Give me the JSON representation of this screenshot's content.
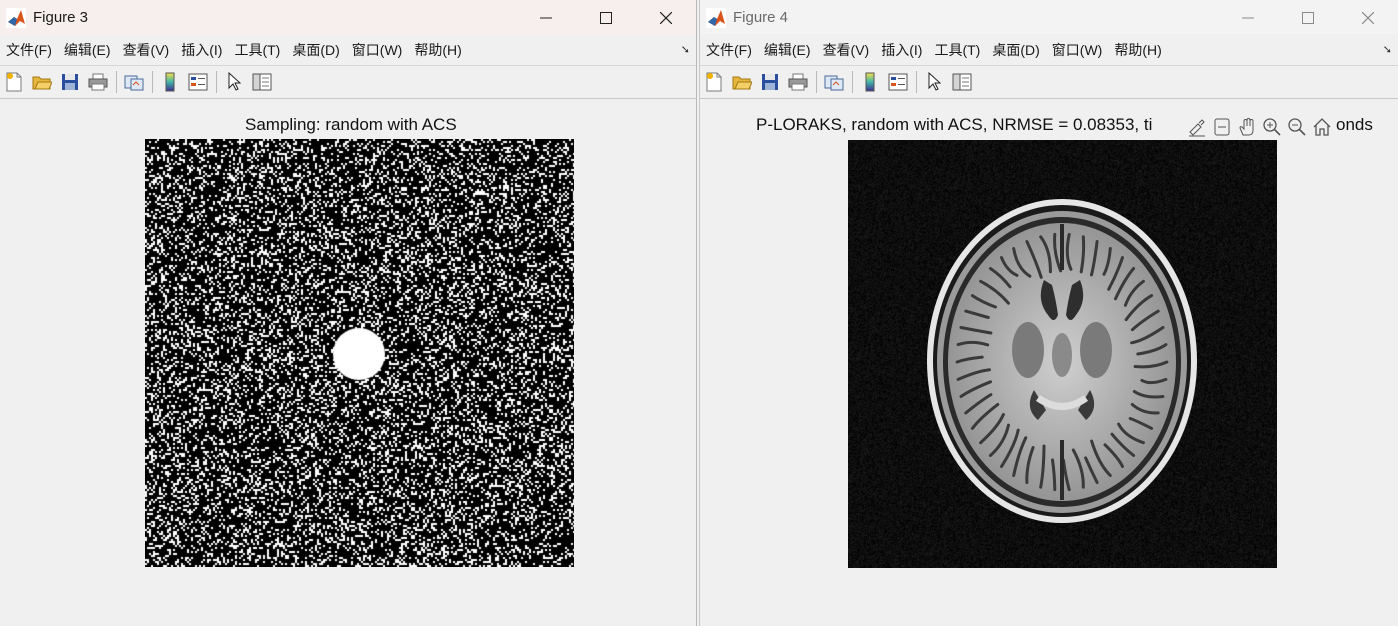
{
  "figure3": {
    "title": "Figure 3",
    "menu": [
      "文件(F)",
      "编辑(E)",
      "查看(V)",
      "插入(I)",
      "工具(T)",
      "桌面(D)",
      "窗口(W)",
      "帮助(H)"
    ],
    "plot_title": "Sampling: random with ACS"
  },
  "figure4": {
    "title": "Figure 4",
    "menu": [
      "文件(F)",
      "编辑(E)",
      "查看(V)",
      "插入(I)",
      "工具(T)",
      "桌面(D)",
      "窗口(W)",
      "帮助(H)"
    ],
    "plot_title": "P-LORAKS, random with ACS, NRMSE = 0.08353, ti",
    "plot_title_tail": "onds"
  },
  "icons": {
    "toolbar": [
      "new-figure-icon",
      "open-file-icon",
      "save-icon",
      "print-icon",
      "link-plot-icon",
      "insert-colorbar-icon",
      "insert-legend-icon",
      "edit-plot-icon",
      "property-inspector-icon"
    ],
    "axes_toolbar": [
      "brush-icon",
      "data-tips-icon",
      "pan-icon",
      "zoom-in-icon",
      "zoom-out-icon",
      "home-icon"
    ]
  },
  "colors": {
    "matlab_orange": "#d9541a",
    "titlebar_active": "#f7efed"
  }
}
